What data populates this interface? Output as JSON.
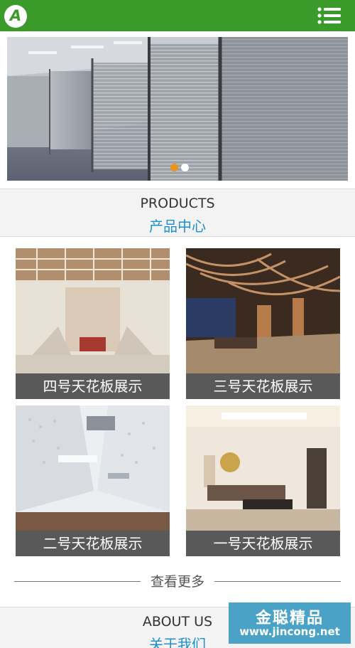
{
  "header": {
    "logo_letter": "A",
    "menu_icon": "hamburger-menu-icon",
    "bar_color": "#3a9a2a"
  },
  "banner": {
    "slides_total": 2,
    "active_slide": 1,
    "active_dot_color": "#e8931e"
  },
  "products": {
    "title_en": "PRODUCTS",
    "title_cn": "产品中心",
    "items": [
      {
        "label": "四号天花板展示"
      },
      {
        "label": "三号天花板展示"
      },
      {
        "label": "二号天花板展示"
      },
      {
        "label": "一号天花板展示"
      }
    ],
    "more_label": "查看更多"
  },
  "about": {
    "title_en": "ABOUT US",
    "title_cn": "关于我们"
  },
  "watermark": {
    "text_cn": "金聪精品",
    "url": "www.jincong.net"
  },
  "colors": {
    "accent_blue": "#1e8fcf",
    "caption_bg": "#595959"
  }
}
